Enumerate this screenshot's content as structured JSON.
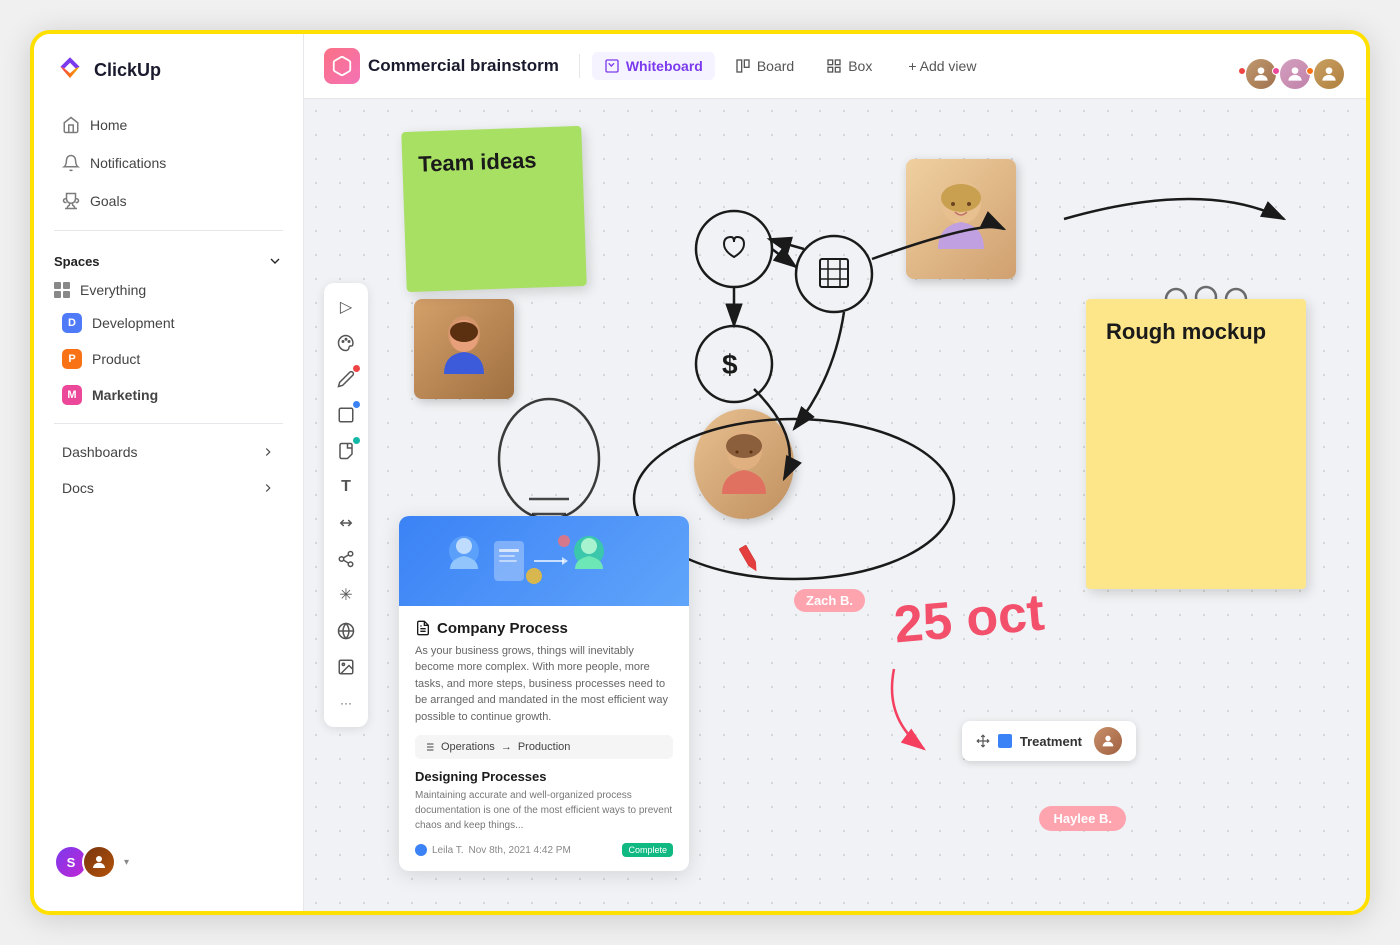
{
  "app": {
    "name": "ClickUp"
  },
  "sidebar": {
    "nav": [
      {
        "id": "home",
        "label": "Home",
        "icon": "home"
      },
      {
        "id": "notifications",
        "label": "Notifications",
        "icon": "bell"
      },
      {
        "id": "goals",
        "label": "Goals",
        "icon": "trophy"
      }
    ],
    "spaces_header": "Spaces",
    "spaces": [
      {
        "id": "everything",
        "label": "Everything",
        "type": "grid"
      },
      {
        "id": "development",
        "label": "Development",
        "badge": "D",
        "color": "blue"
      },
      {
        "id": "product",
        "label": "Product",
        "badge": "P",
        "color": "orange"
      },
      {
        "id": "marketing",
        "label": "Marketing",
        "badge": "M",
        "color": "pink",
        "bold": true
      }
    ],
    "bottom_items": [
      {
        "id": "dashboards",
        "label": "Dashboards"
      },
      {
        "id": "docs",
        "label": "Docs"
      }
    ],
    "user": {
      "avatar1": "S",
      "avatar2": "👤"
    }
  },
  "topbar": {
    "project_name": "Commercial brainstorm",
    "views": [
      {
        "id": "whiteboard",
        "label": "Whiteboard",
        "active": true
      },
      {
        "id": "board",
        "label": "Board",
        "active": false
      },
      {
        "id": "box",
        "label": "Box",
        "active": false
      }
    ],
    "add_view_label": "+ Add view",
    "collaborators": [
      "c1",
      "c2",
      "c3"
    ]
  },
  "canvas": {
    "sticky_green": {
      "text": "Team ideas"
    },
    "sticky_yellow": {
      "text": "Rough mockup"
    },
    "doc_card": {
      "title": "Company Process",
      "body": "As your business grows, things will inevitably become more complex. With more people, more tasks, and more steps, business processes need to be arranged and mandated in the most efficient way possible to continue growth.",
      "flow_from": "Operations",
      "flow_to": "Production",
      "section_title": "Designing Processes",
      "section_text": "Maintaining accurate and well-organized process documentation is one of the most efficient ways to prevent chaos and keep things...",
      "author": "Leila T.",
      "date": "Nov 8th, 2021 4:42 PM",
      "badge": "Complete"
    },
    "labels": {
      "zach": "Zach B.",
      "haylee": "Haylee B.",
      "treatment": "Treatment",
      "date": "25 oct"
    }
  },
  "toolbar": {
    "tools": [
      {
        "id": "cursor",
        "icon": "▷"
      },
      {
        "id": "palette",
        "icon": "⬡"
      },
      {
        "id": "pencil",
        "icon": "✏",
        "dot": "red"
      },
      {
        "id": "rectangle",
        "icon": "▢",
        "dot": "blue"
      },
      {
        "id": "sticky",
        "icon": "▱",
        "dot": "teal"
      },
      {
        "id": "text",
        "icon": "T"
      },
      {
        "id": "connector",
        "icon": "⤢"
      },
      {
        "id": "share",
        "icon": "⬡"
      },
      {
        "id": "asterisk",
        "icon": "✳"
      },
      {
        "id": "globe",
        "icon": "⊕"
      },
      {
        "id": "image",
        "icon": "⊞"
      },
      {
        "id": "more",
        "icon": "•••"
      }
    ]
  }
}
